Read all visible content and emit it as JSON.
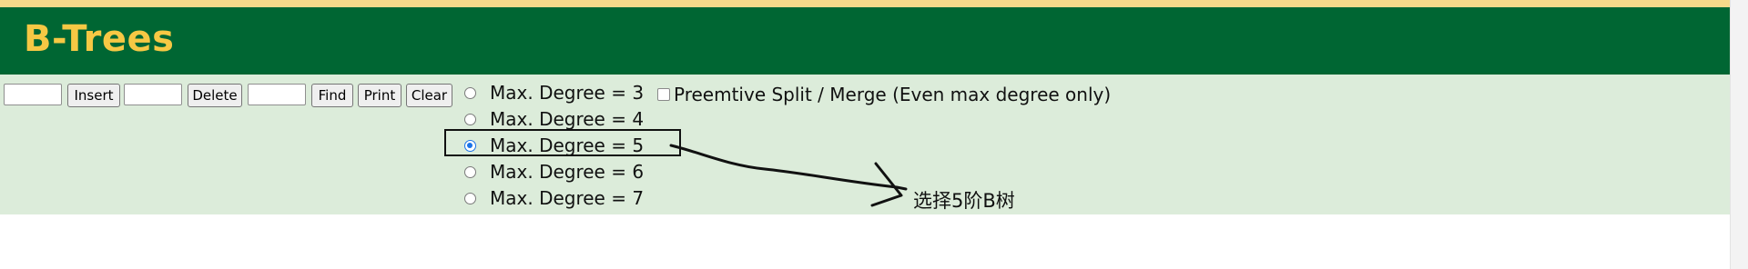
{
  "header": {
    "title": "B-Trees"
  },
  "toolbar": {
    "insert_value": "",
    "insert_label": "Insert",
    "delete_value": "",
    "delete_label": "Delete",
    "find_value": "",
    "find_label": "Find",
    "print_label": "Print",
    "clear_label": "Clear"
  },
  "degree_options": [
    {
      "label": "Max. Degree = 3",
      "checked": false
    },
    {
      "label": "Max. Degree = 4",
      "checked": false
    },
    {
      "label": "Max. Degree = 5",
      "checked": true
    },
    {
      "label": "Max. Degree = 6",
      "checked": false
    },
    {
      "label": "Max. Degree = 7",
      "checked": false
    }
  ],
  "preemptive": {
    "label": "Preemtive Split / Merge (Even max degree only)",
    "checked": false
  },
  "annotation": {
    "text": "选择5阶B树"
  },
  "colors": {
    "header_bg": "#006633",
    "title": "#f6c844",
    "panel_bg": "#dcecda",
    "radio_checked": "#1a73e8"
  }
}
